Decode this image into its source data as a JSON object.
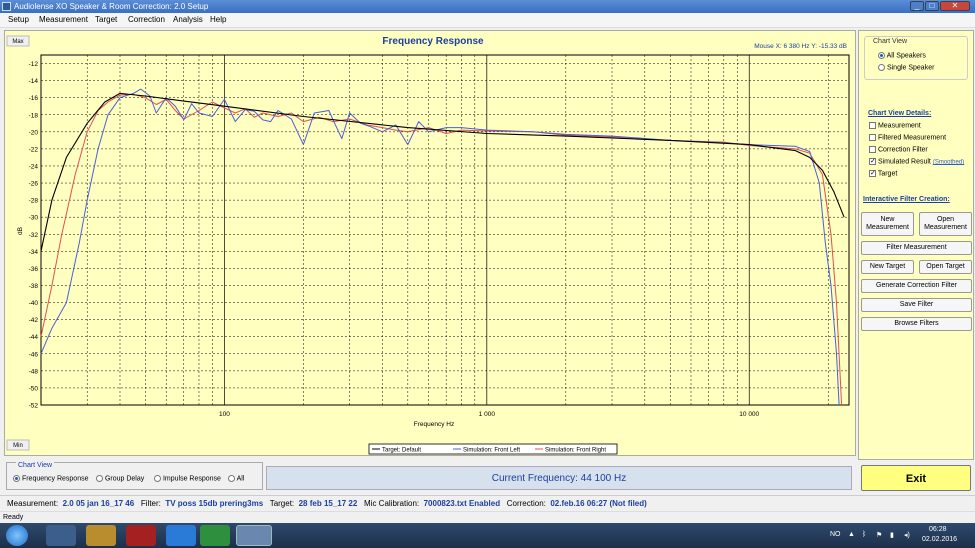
{
  "window": {
    "title": "Audiolense XO Speaker & Room Correction: 2.0 Setup",
    "min": "_",
    "max": "□",
    "close": "✕"
  },
  "menu": [
    "Setup",
    "Measurement",
    "Target",
    "Correction",
    "Analysis",
    "Help"
  ],
  "chart": {
    "max_label": "Max",
    "min_label": "Min",
    "mouse_readout": "Mouse X: 6 380 Hz   Y: -15.33 dB"
  },
  "chart_data": {
    "type": "line",
    "title": "Frequency Response",
    "xlabel": "Frequency Hz",
    "ylabel": "dB",
    "xscale": "log",
    "xlim": [
      20,
      24000
    ],
    "ylim": [
      -52,
      -11
    ],
    "xticks": [
      {
        "v": 100,
        "label": "100"
      },
      {
        "v": 1000,
        "label": "1 000"
      },
      {
        "v": 10000,
        "label": "10 000"
      }
    ],
    "yticks": [
      -12,
      -14,
      -16,
      -18,
      -20,
      -22,
      -24,
      -26,
      -28,
      -30,
      -32,
      -34,
      -36,
      -38,
      -40,
      -42,
      -44,
      -46,
      -48,
      -50,
      -52
    ],
    "grid": true,
    "legend_position": "bottom-center",
    "series": [
      {
        "name": "Target: Default",
        "color": "#000000",
        "x": [
          20,
          22,
          25,
          30,
          35,
          40,
          50,
          70,
          100,
          200,
          500,
          1000,
          2000,
          5000,
          10000,
          15000,
          17000,
          19000,
          21000,
          23000
        ],
        "y": [
          -34,
          -28,
          -23,
          -19,
          -16.5,
          -15.5,
          -15.8,
          -16.4,
          -17,
          -18.2,
          -19.5,
          -20.2,
          -20.5,
          -21,
          -21.5,
          -22.2,
          -23,
          -24.5,
          -27,
          -30
        ]
      },
      {
        "name": "Simulation: Front Left",
        "color": "#4a5fd8",
        "x": [
          20,
          22,
          25,
          28,
          30,
          33,
          36,
          40,
          45,
          48,
          52,
          55,
          60,
          65,
          70,
          75,
          80,
          90,
          100,
          110,
          120,
          130,
          140,
          150,
          160,
          180,
          200,
          220,
          250,
          280,
          300,
          330,
          360,
          400,
          450,
          500,
          550,
          600,
          700,
          800,
          1000,
          1500,
          2000,
          3000,
          5000,
          8000,
          10000,
          15000,
          17000,
          18500,
          19500,
          20500,
          21500,
          22000
        ],
        "y": [
          -46,
          -43,
          -40,
          -33,
          -28,
          -22,
          -18,
          -16,
          -15.5,
          -15,
          -15.8,
          -17.8,
          -16,
          -17,
          -18.6,
          -16.7,
          -17.8,
          -18.2,
          -16.2,
          -18.8,
          -17.4,
          -17.6,
          -18.6,
          -18.8,
          -17.5,
          -18.5,
          -21.5,
          -17.8,
          -17.5,
          -20.8,
          -17.8,
          -19,
          -19.4,
          -20,
          -19.2,
          -21.5,
          -18.8,
          -20,
          -19.5,
          -19.5,
          -19.8,
          -20,
          -20.3,
          -20.5,
          -21,
          -21.3,
          -21.5,
          -21.7,
          -22.3,
          -26,
          -33,
          -38,
          -46,
          -52
        ]
      },
      {
        "name": "Simulation: Front Right",
        "color": "#e05050",
        "x": [
          20,
          22,
          24,
          27,
          30,
          33,
          36,
          40,
          45,
          50,
          55,
          60,
          65,
          70,
          80,
          90,
          100,
          110,
          120,
          130,
          140,
          160,
          180,
          200,
          230,
          260,
          300,
          350,
          400,
          450,
          500,
          600,
          700,
          800,
          1000,
          1500,
          2000,
          3000,
          5000,
          8000,
          10000,
          15000,
          17000,
          19000,
          20500,
          21500,
          22500
        ],
        "y": [
          -44,
          -38,
          -32,
          -25,
          -20,
          -17.5,
          -16.5,
          -15.7,
          -15.6,
          -16,
          -16.8,
          -16.2,
          -17.5,
          -18.5,
          -17.5,
          -16.5,
          -17.2,
          -17.8,
          -17.3,
          -18.3,
          -17.8,
          -18.2,
          -17.8,
          -18.8,
          -18.3,
          -18.8,
          -18.5,
          -19.2,
          -19.5,
          -19.8,
          -20,
          -19.5,
          -20.2,
          -19.8,
          -19.9,
          -20,
          -20.4,
          -20.6,
          -21,
          -21.2,
          -21.6,
          -22,
          -22.5,
          -25,
          -32,
          -40,
          -52
        ]
      }
    ]
  },
  "side": {
    "chart_view_title": "Chart View",
    "radio_all": "All Speakers",
    "radio_single": "Single Speaker",
    "details_title": "Chart View Details:",
    "details": [
      {
        "label": "Measurement",
        "checked": false
      },
      {
        "label": "Filtered Measurement",
        "checked": false
      },
      {
        "label": "Correction Filter",
        "checked": false
      },
      {
        "label": "Simulated Result",
        "checked": true
      },
      {
        "label": "Target",
        "checked": true
      }
    ],
    "smoothed_link": "(Smoothed)",
    "interactive_title": "Interactive Filter Creation:",
    "btn_new_measurement": "New Measurement",
    "btn_open_measurement": "Open Measurement",
    "btn_filter_measurement": "Filter Measurement",
    "btn_new_target": "New Target",
    "btn_open_target": "Open Target",
    "btn_generate": "Generate Correction Filter",
    "btn_save": "Save Filter",
    "btn_browse": "Browse Filters"
  },
  "bottom": {
    "chart_view_title": "Chart View",
    "options": [
      "Frequency Response",
      "Group Delay",
      "Impulse Response",
      "All"
    ],
    "current_frequency": "Current Frequency: 44 100 Hz",
    "exit": "Exit"
  },
  "info": {
    "measurement_label": "Measurement:",
    "measurement_value": "2.0 05 jan 16_17 46",
    "filter_label": "Filter:",
    "filter_value": "TV poss 15db prering3ms",
    "target_label": "Target:",
    "target_value": "28 feb 15_17 22",
    "mic_label": "Mic Calibration:",
    "mic_value": "7000823.txt Enabled",
    "correction_label": "Correction:",
    "correction_value": "02.feb.16 06:27 (Not filed)"
  },
  "status": "Ready",
  "taskbar": {
    "lang": "NO",
    "time": "06:28",
    "date": "02.02.2016"
  },
  "colors": {
    "plot_bg": "#ffffc0",
    "accent": "#1a3fa0",
    "exit_bg": "#ffff80"
  }
}
